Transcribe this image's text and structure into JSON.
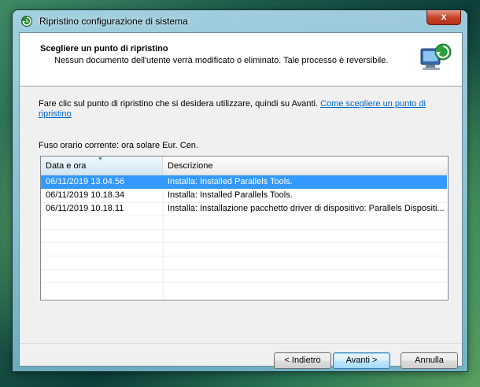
{
  "window": {
    "title": "Ripristino configurazione di sistema",
    "close_label": "x"
  },
  "header": {
    "title": "Scegliere un punto di ripristino",
    "subtitle": "Nessun documento dell'utente verrà modificato o eliminato. Tale processo è reversibile."
  },
  "body": {
    "instruction": "Fare clic sul punto di ripristino che si desidera utilizzare, quindi su Avanti.",
    "help_link": "Come scegliere un punto di ripristino",
    "timezone": "Fuso orario corrente: ora solare Eur. Cen."
  },
  "list": {
    "columns": [
      "Data e ora",
      "Descrizione"
    ],
    "rows": [
      {
        "date": "06/11/2019 13.04.56",
        "desc": "Installa: Installed Parallels Tools.",
        "selected": true
      },
      {
        "date": "06/11/2019 10.18.34",
        "desc": "Installa: Installed Parallels Tools.",
        "selected": false
      },
      {
        "date": "06/11/2019 10.18.11",
        "desc": "Installa: Installazione pacchetto driver di dispositivo: Parallels Dispositi...",
        "selected": false
      }
    ]
  },
  "buttons": {
    "back": "< Indietro",
    "next": "Avanti >",
    "cancel": "Annulla"
  },
  "colors": {
    "selection": "#3399ff",
    "link": "#0066cc"
  }
}
